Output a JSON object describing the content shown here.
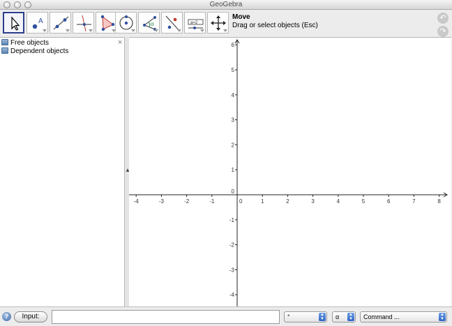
{
  "window": {
    "title": "GeoGebra"
  },
  "toolbar": {
    "tools": [
      {
        "name": "move-tool",
        "icon": "cursor-arrow-icon"
      },
      {
        "name": "point-tool",
        "icon": "point-a-icon"
      },
      {
        "name": "line-tool",
        "icon": "line-two-points-icon"
      },
      {
        "name": "perpendicular-tool",
        "icon": "perpendicular-line-icon"
      },
      {
        "name": "polygon-tool",
        "icon": "polygon-icon"
      },
      {
        "name": "circle-tool",
        "icon": "circle-center-point-icon"
      },
      {
        "name": "angle-tool",
        "icon": "angle-icon"
      },
      {
        "name": "reflect-tool",
        "icon": "reflect-line-icon"
      },
      {
        "name": "slider-tool",
        "icon": "slider-icon"
      },
      {
        "name": "move-view-tool",
        "icon": "move-graphics-view-icon"
      }
    ],
    "active_tool": {
      "name": "Move",
      "hint": "Drag or select objects (Esc)"
    },
    "undo_icon": "undo-icon",
    "redo_icon": "redo-icon"
  },
  "algebra": {
    "items": [
      {
        "label": "Free objects"
      },
      {
        "label": "Dependent objects"
      }
    ],
    "close_label": "×"
  },
  "graphics": {
    "x_ticks": [
      "-4",
      "-3",
      "-2",
      "-1",
      "0",
      "1",
      "2",
      "3",
      "4",
      "5",
      "6",
      "7",
      "8"
    ],
    "y_ticks": [
      "6",
      "5",
      "4",
      "3",
      "2",
      "1",
      "0",
      "-1",
      "-2",
      "-3",
      "-4"
    ]
  },
  "inputbar": {
    "help_label": "?",
    "input_button_label": "Input:",
    "input_value": "",
    "symbol_select_value": "°",
    "greek_select_value": "α",
    "command_select_value": "Command ..."
  }
}
